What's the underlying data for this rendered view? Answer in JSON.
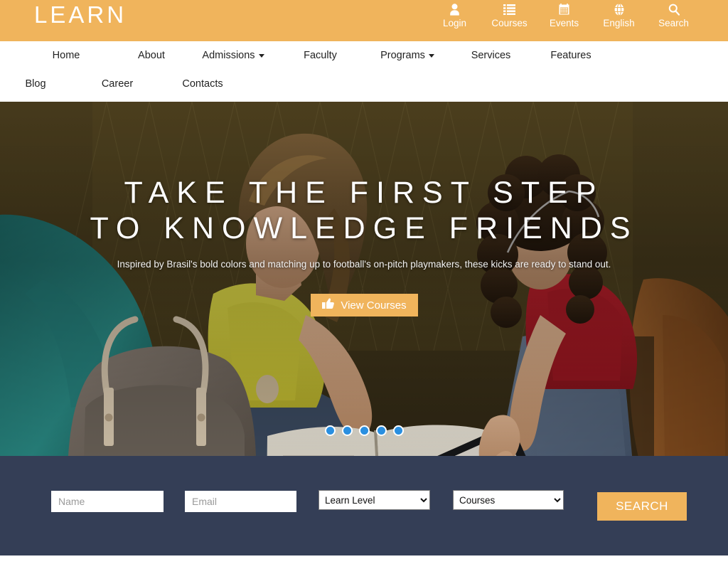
{
  "brand": {
    "name": "LEARN"
  },
  "colors": {
    "accent": "#f0b45c",
    "band": "#343e56",
    "nav_text": "#222222",
    "dot_active": "#2a8fe0",
    "white": "#ffffff"
  },
  "topbar": {
    "links": [
      {
        "label": "Login",
        "icon": "user-icon"
      },
      {
        "label": "Courses",
        "icon": "list-icon"
      },
      {
        "label": "Events",
        "icon": "calendar-icon"
      },
      {
        "label": "English",
        "icon": "globe-icon"
      },
      {
        "label": "Search",
        "icon": "search-icon"
      }
    ]
  },
  "nav": {
    "items": [
      {
        "label": "Home",
        "has_dropdown": false,
        "width": 130
      },
      {
        "label": "About",
        "has_dropdown": false,
        "width": 110
      },
      {
        "label": "Admissions",
        "has_dropdown": true,
        "width": 120
      },
      {
        "label": "Faculty",
        "has_dropdown": false,
        "width": 125
      },
      {
        "label": "Programs",
        "has_dropdown": true,
        "width": 120
      },
      {
        "label": "Services",
        "has_dropdown": false,
        "width": 115
      },
      {
        "label": "Features",
        "has_dropdown": false,
        "width": 110
      },
      {
        "label": "Blog",
        "has_dropdown": false,
        "width": 100
      },
      {
        "label": "Career",
        "has_dropdown": false,
        "width": 130
      },
      {
        "label": "Contacts",
        "has_dropdown": false,
        "width": 110
      }
    ]
  },
  "hero": {
    "title_line1": "TAKE THE FIRST STEP",
    "title_line2": "TO KNOWLEDGE FRIENDS",
    "subtitle": "Inspired by Brasil's bold colors and matching up to football's on-pitch playmakers, these kicks are ready to stand out.",
    "cta_label": "View Courses",
    "cta_icon": "thumbs-up-icon",
    "slide_count": 5,
    "active_slide": 1
  },
  "search_form": {
    "name_placeholder": "Name",
    "name_value": "",
    "email_placeholder": "Email",
    "email_value": "",
    "level_selected": "Learn Level",
    "level_options": [
      "Learn Level"
    ],
    "course_selected": "Courses",
    "course_options": [
      "Courses"
    ],
    "submit_label": "SEARCH"
  }
}
